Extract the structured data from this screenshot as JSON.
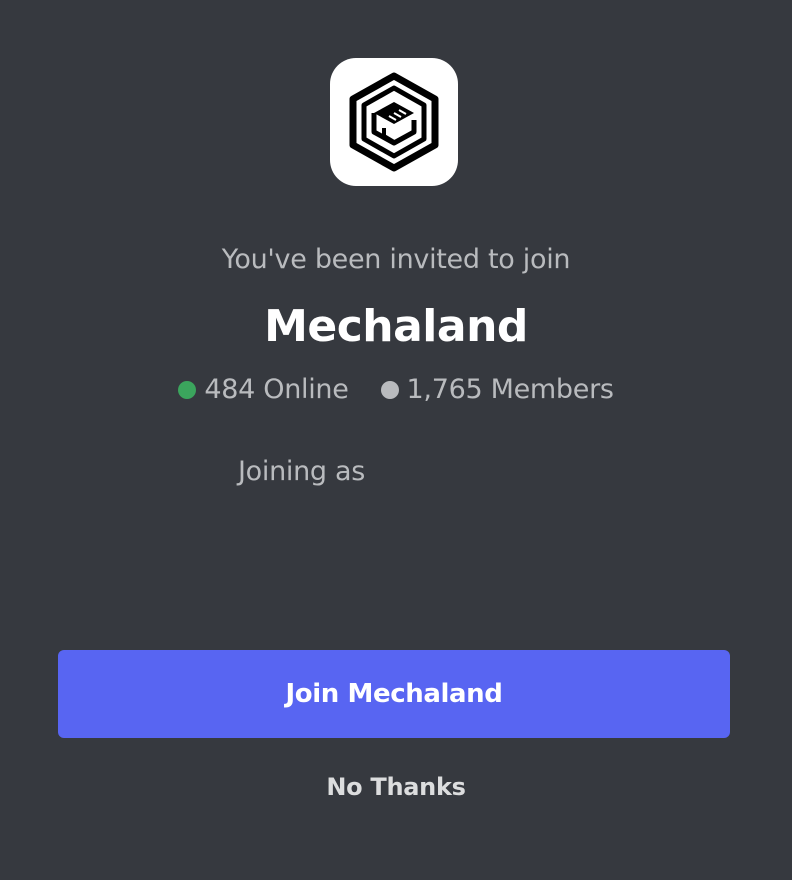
{
  "invite": {
    "subtitle": "You've been invited to join",
    "server_name": "Mechaland",
    "online_count": "484 Online",
    "member_count": "1,765 Members",
    "joining_as_label": "Joining as",
    "join_button_label": "Join Mechaland",
    "decline_label": "No Thanks"
  },
  "icons": {
    "server_icon": "mechaland-logo-icon",
    "online_dot": "status-online-dot-icon",
    "members_dot": "status-members-dot-icon"
  },
  "colors": {
    "background": "#36393f",
    "accent": "#5865f2",
    "online": "#3ba55d",
    "members": "#b9bbbe",
    "muted_text": "#b9bbbe",
    "title_text": "#ffffff"
  }
}
